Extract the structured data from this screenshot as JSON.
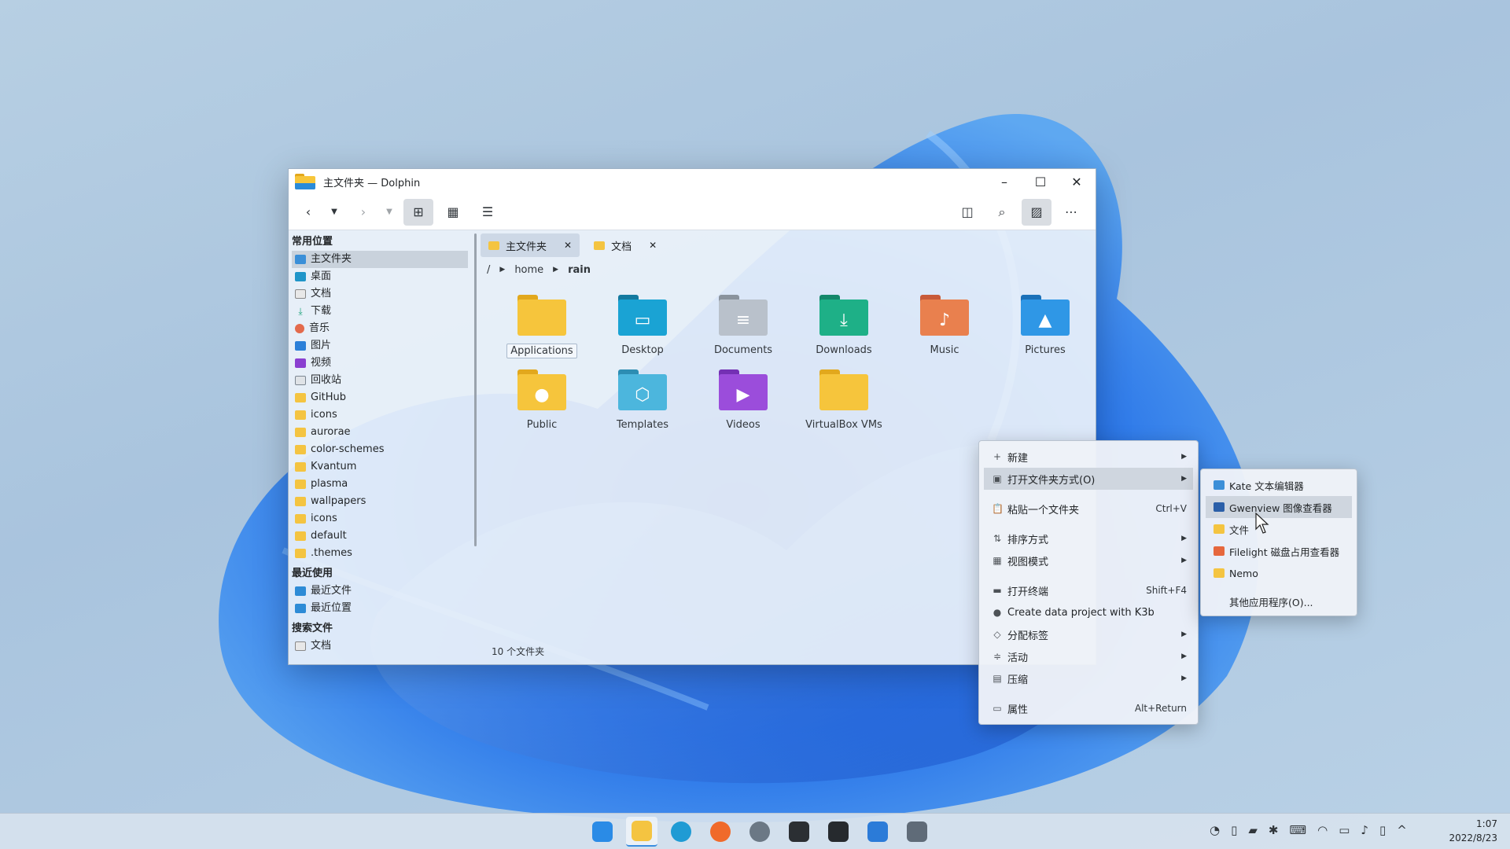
{
  "window": {
    "title": "主文件夹 — Dolphin",
    "controls": {
      "minimize": "–",
      "maximize": "☐",
      "close": "✕"
    }
  },
  "sidebar": {
    "sections": [
      {
        "title": "常用位置",
        "items": [
          {
            "label": "主文件夹",
            "icon": "home-icon",
            "selected": true
          },
          {
            "label": "桌面",
            "icon": "desktop-icon"
          },
          {
            "label": "文档",
            "icon": "document-icon"
          },
          {
            "label": "下载",
            "icon": "download-icon"
          },
          {
            "label": "音乐",
            "icon": "music-icon"
          },
          {
            "label": "图片",
            "icon": "picture-icon"
          },
          {
            "label": "视频",
            "icon": "video-icon"
          },
          {
            "label": "回收站",
            "icon": "trash-icon"
          },
          {
            "label": "GitHub",
            "icon": "folder-icon"
          },
          {
            "label": "icons",
            "icon": "folder-icon"
          },
          {
            "label": "aurorae",
            "icon": "folder-icon"
          },
          {
            "label": "color-schemes",
            "icon": "folder-icon"
          },
          {
            "label": "Kvantum",
            "icon": "folder-icon"
          },
          {
            "label": "plasma",
            "icon": "folder-icon"
          },
          {
            "label": "wallpapers",
            "icon": "folder-icon"
          },
          {
            "label": "icons",
            "icon": "folder-icon"
          },
          {
            "label": "default",
            "icon": "folder-icon"
          },
          {
            "label": ".themes",
            "icon": "folder-icon"
          }
        ]
      },
      {
        "title": "最近使用",
        "items": [
          {
            "label": "最近文件",
            "icon": "recent-files-icon"
          },
          {
            "label": "最近位置",
            "icon": "recent-locations-icon"
          }
        ]
      },
      {
        "title": "搜索文件",
        "items": [
          {
            "label": "文档",
            "icon": "document-icon"
          }
        ]
      }
    ]
  },
  "tabs": [
    {
      "label": "主文件夹",
      "active": true
    },
    {
      "label": "文档",
      "active": false
    }
  ],
  "breadcrumb": {
    "root": "/",
    "parts": [
      "home",
      "rain"
    ]
  },
  "files": [
    {
      "name": "Applications",
      "color": "#f6c53c",
      "dark": "#e2a81d",
      "glyph": "",
      "selected": true
    },
    {
      "name": "Desktop",
      "color": "#1aa3d4",
      "dark": "#13799f",
      "glyph": "▭"
    },
    {
      "name": "Documents",
      "color": "#b9c1cb",
      "dark": "#8a939d",
      "glyph": "≡"
    },
    {
      "name": "Downloads",
      "color": "#1eb087",
      "dark": "#14876a",
      "glyph": "⤓"
    },
    {
      "name": "Music",
      "color": "#e9804e",
      "dark": "#c85a39",
      "glyph": "♪"
    },
    {
      "name": "Pictures",
      "color": "#2f97e6",
      "dark": "#1a70b8",
      "glyph": "▲"
    },
    {
      "name": "Public",
      "color": "#f6c53c",
      "dark": "#e2a81d",
      "glyph": "●"
    },
    {
      "name": "Templates",
      "color": "#4cb6dd",
      "dark": "#2d8db3",
      "glyph": "⬡"
    },
    {
      "name": "Videos",
      "color": "#9b4ddb",
      "dark": "#7430b4",
      "glyph": "▶"
    },
    {
      "name": "VirtualBox VMs",
      "color": "#f6c53c",
      "dark": "#e2a81d",
      "glyph": ""
    }
  ],
  "status": "10 个文件夹",
  "context_menu": {
    "items": [
      {
        "label": "新建",
        "icon": "plus-icon",
        "glyph": "+",
        "submenu": true
      },
      {
        "label": "打开文件夹方式(O)",
        "icon": "open-with-icon",
        "glyph": "▣",
        "submenu": true,
        "highlighted": true
      },
      {
        "label": "粘贴一个文件夹",
        "icon": "paste-icon",
        "glyph": "📋",
        "shortcut": "Ctrl+V",
        "gap": true
      },
      {
        "label": "排序方式",
        "icon": "sort-icon",
        "glyph": "⇅",
        "submenu": true,
        "gap": true
      },
      {
        "label": "视图模式",
        "icon": "view-mode-icon",
        "glyph": "▦",
        "submenu": true
      },
      {
        "label": "打开终端",
        "icon": "terminal-icon",
        "glyph": "▬",
        "shortcut": "Shift+F4",
        "gap": true
      },
      {
        "label": "Create data project with K3b",
        "icon": "k3b-icon",
        "glyph": "●"
      },
      {
        "label": "分配标签",
        "icon": "tag-icon",
        "glyph": "◇",
        "submenu": true
      },
      {
        "label": "活动",
        "icon": "activity-icon",
        "glyph": "≑",
        "submenu": true
      },
      {
        "label": "压缩",
        "icon": "compress-icon",
        "glyph": "▤",
        "submenu": true
      },
      {
        "label": "属性",
        "icon": "properties-icon",
        "glyph": "▭",
        "shortcut": "Alt+Return",
        "gap": true
      }
    ]
  },
  "open_with_submenu": {
    "items": [
      {
        "label": "Kate 文本编辑器",
        "icon": "kate-icon",
        "color": "#3d8fd8"
      },
      {
        "label": "Gwenview 图像查看器",
        "icon": "gwenview-icon",
        "color": "#2b5fa8",
        "highlighted": true
      },
      {
        "label": "文件",
        "icon": "files-icon",
        "color": "#f4c441"
      },
      {
        "label": "Filelight 磁盘占用查看器",
        "icon": "filelight-icon",
        "color": "#e6673d"
      },
      {
        "label": "Nemo",
        "icon": "nemo-icon",
        "color": "#f4c441"
      },
      {
        "label": "其他应用程序(O)...",
        "icon": "",
        "color": "",
        "gap": true
      }
    ]
  },
  "taskbar": {
    "apps": [
      {
        "name": "start-menu-icon",
        "color": "#2a8be6",
        "active": false
      },
      {
        "name": "dolphin-file-manager-icon",
        "color": "#f4c441",
        "active": true
      },
      {
        "name": "edge-dev-icon",
        "color": "#1f9bd4",
        "active": false
      },
      {
        "name": "firefox-icon",
        "color": "#f06a2a",
        "active": false
      },
      {
        "name": "chrome-icon",
        "color": "#6b7885",
        "active": false
      },
      {
        "name": "github-icon",
        "color": "#2b2f33",
        "active": false
      },
      {
        "name": "figma-icon",
        "color": "#262a2e",
        "active": false
      },
      {
        "name": "store-icon",
        "color": "#2b7bd8",
        "active": false
      },
      {
        "name": "virtualbox-icon",
        "color": "#5f6b78",
        "active": false
      }
    ],
    "tray": [
      "◔",
      "▯",
      "▰",
      "✱",
      "⌨",
      "◠",
      "▭",
      "♪",
      "▯",
      "^"
    ],
    "time": "1:07",
    "date": "2022/8/23"
  }
}
